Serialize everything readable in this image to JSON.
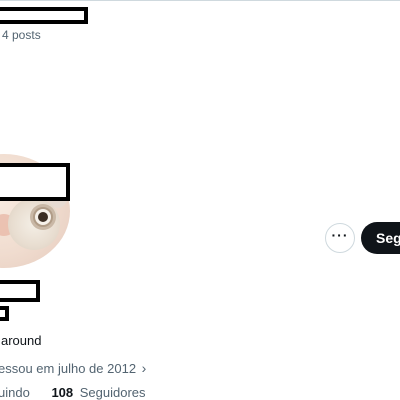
{
  "header": {
    "post_count": "4 posts"
  },
  "profile": {
    "bio": "around",
    "joined": "essou em julho de 2012",
    "joined_chevron": "›",
    "following_label": "uindo",
    "followers_count": "108",
    "followers_label": "Seguidores"
  },
  "actions": {
    "more_label": "···",
    "follow_label": "Seguir",
    "follow_label_visible": "Seg"
  },
  "icons": {
    "more": "more-horizontal-icon",
    "chevron": "chevron-right-icon"
  },
  "colors": {
    "primary_text": "#0f1419",
    "secondary_text": "#536471",
    "follow_button_bg": "#0f1419",
    "border": "#cfd9de",
    "redaction": "#000000"
  }
}
